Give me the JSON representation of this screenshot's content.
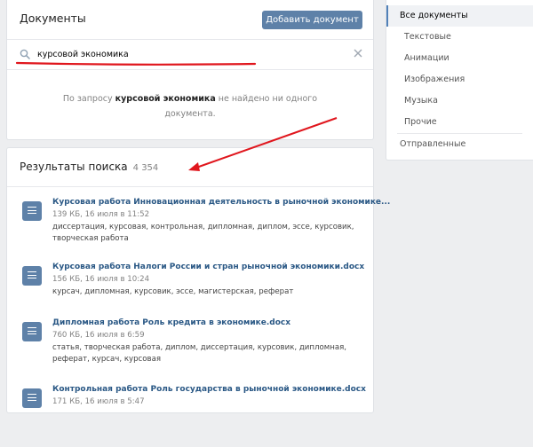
{
  "header": {
    "title": "Документы",
    "add_button": "Добавить документ"
  },
  "search": {
    "value": "курсовой экономика",
    "placeholder": ""
  },
  "empty": {
    "before": "По запросу ",
    "query": "курсовой экономика",
    "after": " не найдено ни одного документа."
  },
  "results": {
    "title": "Результаты поиска",
    "count": "4 354",
    "items": [
      {
        "title": "Курсовая работа Инновационная деятельность в рыночной экономике...",
        "meta": "139 КБ, 16 июля в 11:52",
        "tags": "диссертация, курсовая, контрольная, дипломная, диплом, эссе, курсовик, творческая работа"
      },
      {
        "title": "Курсовая работа Налоги России и стран рыночной экономики.docx",
        "meta": "156 КБ, 16 июля в 10:24",
        "tags": "курсач, дипломная, курсовик, эссе, магистерская, реферат"
      },
      {
        "title": "Дипломная работа Роль кредита в экономике.docx",
        "meta": "760 КБ, 16 июля в 6:59",
        "tags": "статья, творческая работа, диплом, диссертация, курсовик, дипломная, реферат, курсач, курсовая"
      },
      {
        "title": "Контрольная работа Роль государства в рыночной экономике.docx",
        "meta": "171 КБ, 16 июля в 5:47",
        "tags": ""
      }
    ]
  },
  "sidebar": {
    "items": [
      {
        "label": "Все документы"
      },
      {
        "label": "Текстовые"
      },
      {
        "label": "Анимации"
      },
      {
        "label": "Изображения"
      },
      {
        "label": "Музыка"
      },
      {
        "label": "Прочие"
      },
      {
        "label": "Отправленные"
      }
    ]
  },
  "colors": {
    "accent": "#5e81a8",
    "link": "#2a5885",
    "annotation": "#e0161d"
  },
  "icons": [
    "search-icon",
    "clear-icon",
    "document-icon"
  ]
}
